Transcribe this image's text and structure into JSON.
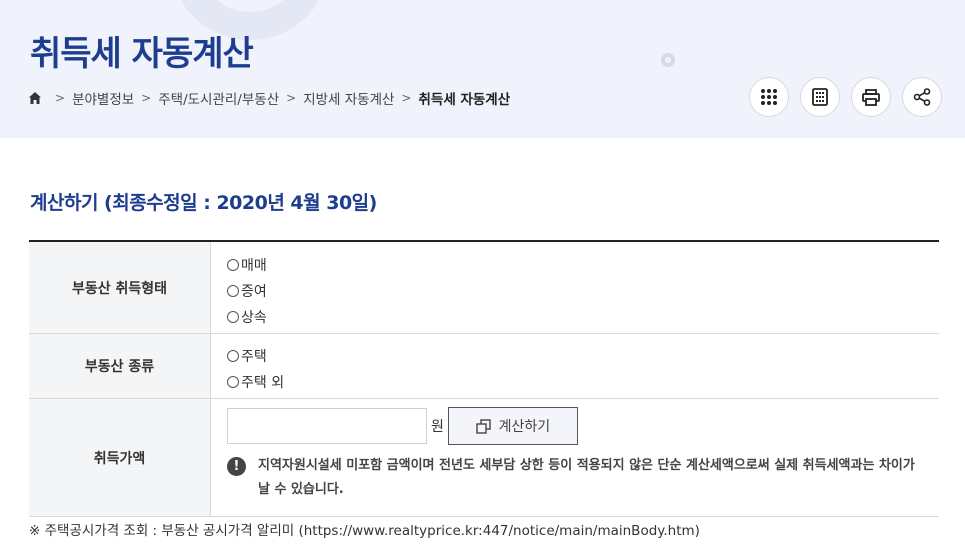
{
  "header": {
    "title": "취득세 자동계산",
    "breadcrumb": [
      "분야별정보",
      "주택/도시관리/부동산",
      "지방세 자동계산",
      "취득세 자동계산"
    ],
    "tools": [
      "menu-icon",
      "calculator-icon",
      "print-icon",
      "share-icon"
    ]
  },
  "section": {
    "title": "계산하기 (최종수정일 : 2020년 4월 30일)"
  },
  "form": {
    "acquisition_type": {
      "label": "부동산 취득형태",
      "options": [
        "매매",
        "증여",
        "상속"
      ]
    },
    "property_type": {
      "label": "부동산 종류",
      "options": [
        "주택",
        "주택 외"
      ]
    },
    "acquisition_price": {
      "label": "취득가액",
      "value": "",
      "unit": "원",
      "button_label": "계산하기",
      "notice": "지역자원시설세 미포함 금액이며 전년도 세부담 상한 등이 적용되지 않은 단순 계산세액으로써 실제 취득세액과는 차이가 날 수 있습니다."
    }
  },
  "footnote": "※ 주택공시가격 조회 : 부동산 공시가격 알리미 (https://www.realtyprice.kr:447/notice/main/mainBody.htm)",
  "colors": {
    "accent": "#1e3d8f",
    "header_bg": "#f0f3fb"
  }
}
